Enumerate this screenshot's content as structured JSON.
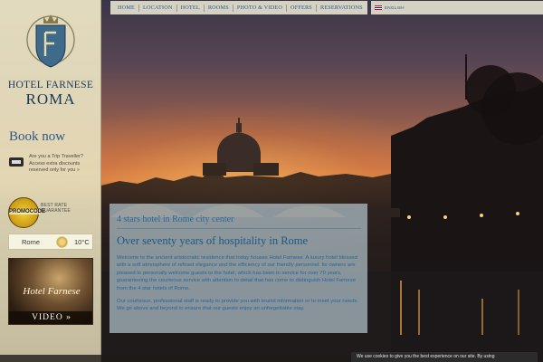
{
  "brand": {
    "name": "HOTEL FARNESE",
    "city": "ROMA"
  },
  "nav": {
    "items": [
      "HOME",
      "LOCATION",
      "HOTEL",
      "ROOMS",
      "PHOTO & VIDEO",
      "OFFERS",
      "RESERVATIONS"
    ]
  },
  "language": {
    "label": "ENGLISH"
  },
  "sidebar": {
    "book_now": "Book now",
    "tripadvisor_text": "Are you a Trip Traveller? Access extra discounts reserved only for you »",
    "promo_badge": "PROMOCODE",
    "promo_text": "BEST RATE GUARANTEE",
    "weather": {
      "city": "Rome",
      "temperature": "10°C",
      "icon": "sun-icon"
    },
    "video": {
      "title": "Hotel Farnese",
      "label": "VIDEO »"
    }
  },
  "content": {
    "kicker": "4 stars hotel in Rome city center",
    "heading": "Over seventy years of hospitality in Rome",
    "paragraphs": [
      "Welcome to the ancient aristocratic residence that today houses Hotel Farnese. A luxury hotel blessed with a soft atmosphere of refined elegance and the efficiency of our friendly personnel. Its owners are pleased to personally welcome guests to the hotel, which has been in service for over 70 years, guaranteeing the courteous service with attention to detail that has come to distinguish Hotel Farnese from the 4 star hotels of Rome.",
      "Our courteous, professional staff is ready to provide you with tourist information or to meet your needs.",
      "We go above and beyond to ensure that our guests enjoy an unforgettable stay."
    ]
  },
  "cookie": {
    "text": "We use cookies to give you the best experience on our site. By using"
  },
  "colors": {
    "nav_link": "#2a5a86",
    "brand_blue": "#14385a",
    "body_text": "#2466a0"
  }
}
